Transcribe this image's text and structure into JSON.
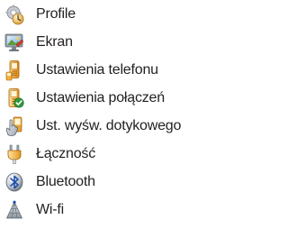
{
  "menu": {
    "items": [
      {
        "label": "Profile",
        "icon": "profiles-gear-icon"
      },
      {
        "label": "Ekran",
        "icon": "display-monitor-icon"
      },
      {
        "label": "Ustawienia telefonu",
        "icon": "phone-settings-icon"
      },
      {
        "label": "Ustawienia połączeń",
        "icon": "call-settings-icon"
      },
      {
        "label": "Ust. wyśw. dotykowego",
        "icon": "touch-hand-icon"
      },
      {
        "label": "Łączność",
        "icon": "usb-connector-icon"
      },
      {
        "label": "Bluetooth",
        "icon": "bluetooth-icon"
      },
      {
        "label": "Wi-fi",
        "icon": "wifi-antenna-icon"
      }
    ]
  }
}
